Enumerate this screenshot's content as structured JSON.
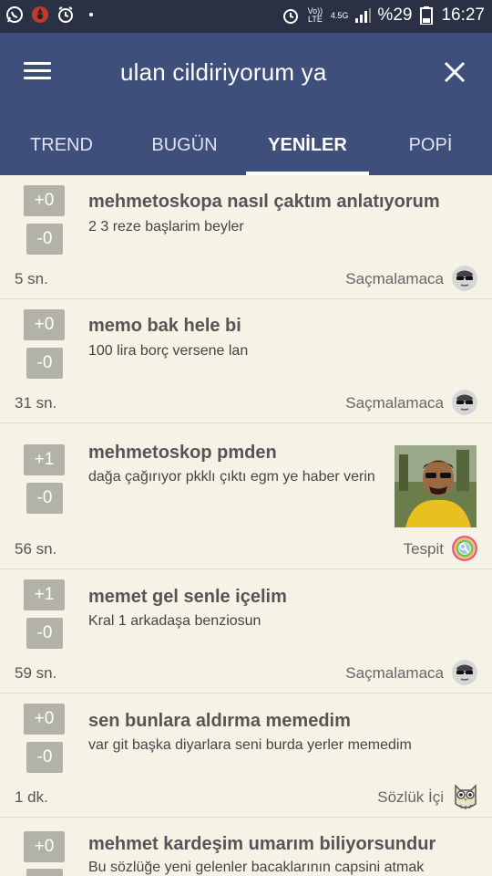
{
  "status_bar": {
    "volte": "Vo)) LTE",
    "network": "4.5G",
    "battery": "%29",
    "time": "16:27"
  },
  "header": {
    "title": "ulan cildiriyorum ya",
    "tabs": [
      {
        "label": "TREND"
      },
      {
        "label": "BUGÜN"
      },
      {
        "label": "YENİLER"
      },
      {
        "label": "POPİ"
      }
    ],
    "active_tab": "YENİLER"
  },
  "entries": [
    {
      "up": "+0",
      "down": "-0",
      "title": "mehmetoskopa nasıl çaktım anlatıyorum",
      "desc": "2 3 reze başlarim beyler",
      "time": "5 sn.",
      "category": "Saçmalamaca",
      "icon": "sunglasses-face-icon"
    },
    {
      "up": "+0",
      "down": "-0",
      "title": "memo bak hele bi",
      "desc": "100 lira borç versene lan",
      "time": "31 sn.",
      "category": "Saçmalamaca",
      "icon": "sunglasses-face-icon"
    },
    {
      "up": "+1",
      "down": "-0",
      "title": "mehmetoskop pmden",
      "desc": "dağa çağırıyor pkklı çıktı egm ye haber verin",
      "time": "56 sn.",
      "category": "Tespit",
      "icon": "rainbow-magnifier-icon",
      "has_thumbnail": true
    },
    {
      "up": "+1",
      "down": "-0",
      "title": "memet gel senle içelim",
      "desc": "Kral 1 arkadaşa benziosun",
      "time": "59 sn.",
      "category": "Saçmalamaca",
      "icon": "sunglasses-face-icon"
    },
    {
      "up": "+0",
      "down": "-0",
      "title": "sen bunlara aldırma memedim",
      "desc": "var git başka diyarlara seni burda yerler memedim",
      "time": "1 dk.",
      "category": "Sözlük İçi",
      "icon": "owl-icon"
    },
    {
      "up": "+0",
      "down": "",
      "title": "mehmet kardeşim umarım biliyorsundur",
      "desc": "Bu sözlüğe yeni gelenler bacaklarının capsini atmak"
    }
  ],
  "colors": {
    "status_bar": "#2b3144",
    "app_bar": "#3e4f7c",
    "background": "#f5f3e6",
    "vote_button": "#b2b2a8"
  }
}
